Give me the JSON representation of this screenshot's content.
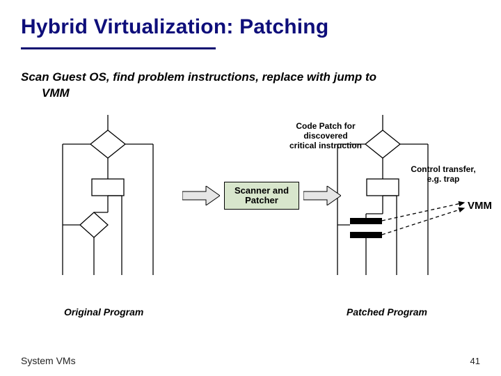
{
  "title": "Hybrid Virtualization: Patching",
  "subtitle_line1": "Scan Guest OS, find problem instructions, replace with jump to",
  "subtitle_line2": "VMM",
  "labels": {
    "code_patch": "Code Patch for\ndiscovered\ncritical instruction",
    "scanner": "Scanner and\nPatcher",
    "control_transfer": "Control transfer,\ne.g. trap",
    "vmm": "VMM",
    "original": "Original Program",
    "patched": "Patched Program"
  },
  "footer": "System VMs",
  "page": "41"
}
